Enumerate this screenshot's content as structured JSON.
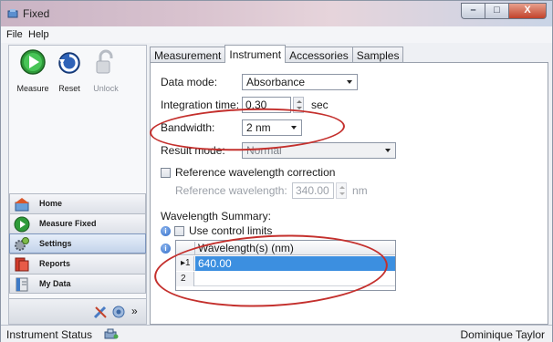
{
  "window": {
    "title": "Fixed"
  },
  "menu": [
    "File",
    "Help"
  ],
  "toolbar": {
    "measure": "Measure",
    "reset": "Reset",
    "unlock": "Unlock"
  },
  "nav": [
    {
      "label": "Home",
      "icon": "home-icon"
    },
    {
      "label": "Measure Fixed",
      "icon": "measure-fixed-icon"
    },
    {
      "label": "Settings",
      "icon": "settings-icon"
    },
    {
      "label": "Reports",
      "icon": "reports-icon"
    },
    {
      "label": "My Data",
      "icon": "my-data-icon"
    }
  ],
  "nav_overflow": "»",
  "tabs": [
    "Measurement",
    "Instrument",
    "Accessories",
    "Samples"
  ],
  "active_tab": "Instrument",
  "instrument": {
    "data_mode_label": "Data mode:",
    "data_mode_value": "Absorbance",
    "integration_time_label": "Integration time:",
    "integration_time_value": "0.30",
    "integration_time_unit": "sec",
    "bandwidth_label": "Bandwidth:",
    "bandwidth_value": "2 nm",
    "result_mode_label": "Result mode:",
    "result_mode_value": "Normal",
    "ref_correction_label": "Reference wavelength correction",
    "ref_wavelength_label": "Reference wavelength:",
    "ref_wavelength_value": "340.00",
    "ref_wavelength_unit": "nm",
    "summary_label": "Wavelength Summary:",
    "control_limits_label": "Use control limits",
    "grid_header": "Wavelength(s) (nm)",
    "grid_rows": [
      {
        "marker": "▸1",
        "value": "640.00"
      },
      {
        "marker": "2",
        "value": ""
      }
    ]
  },
  "status": {
    "left": "Instrument Status",
    "right": "Dominique Taylor"
  },
  "colors": {
    "accent": "#3c8fe0",
    "annotation": "#c4302d"
  }
}
